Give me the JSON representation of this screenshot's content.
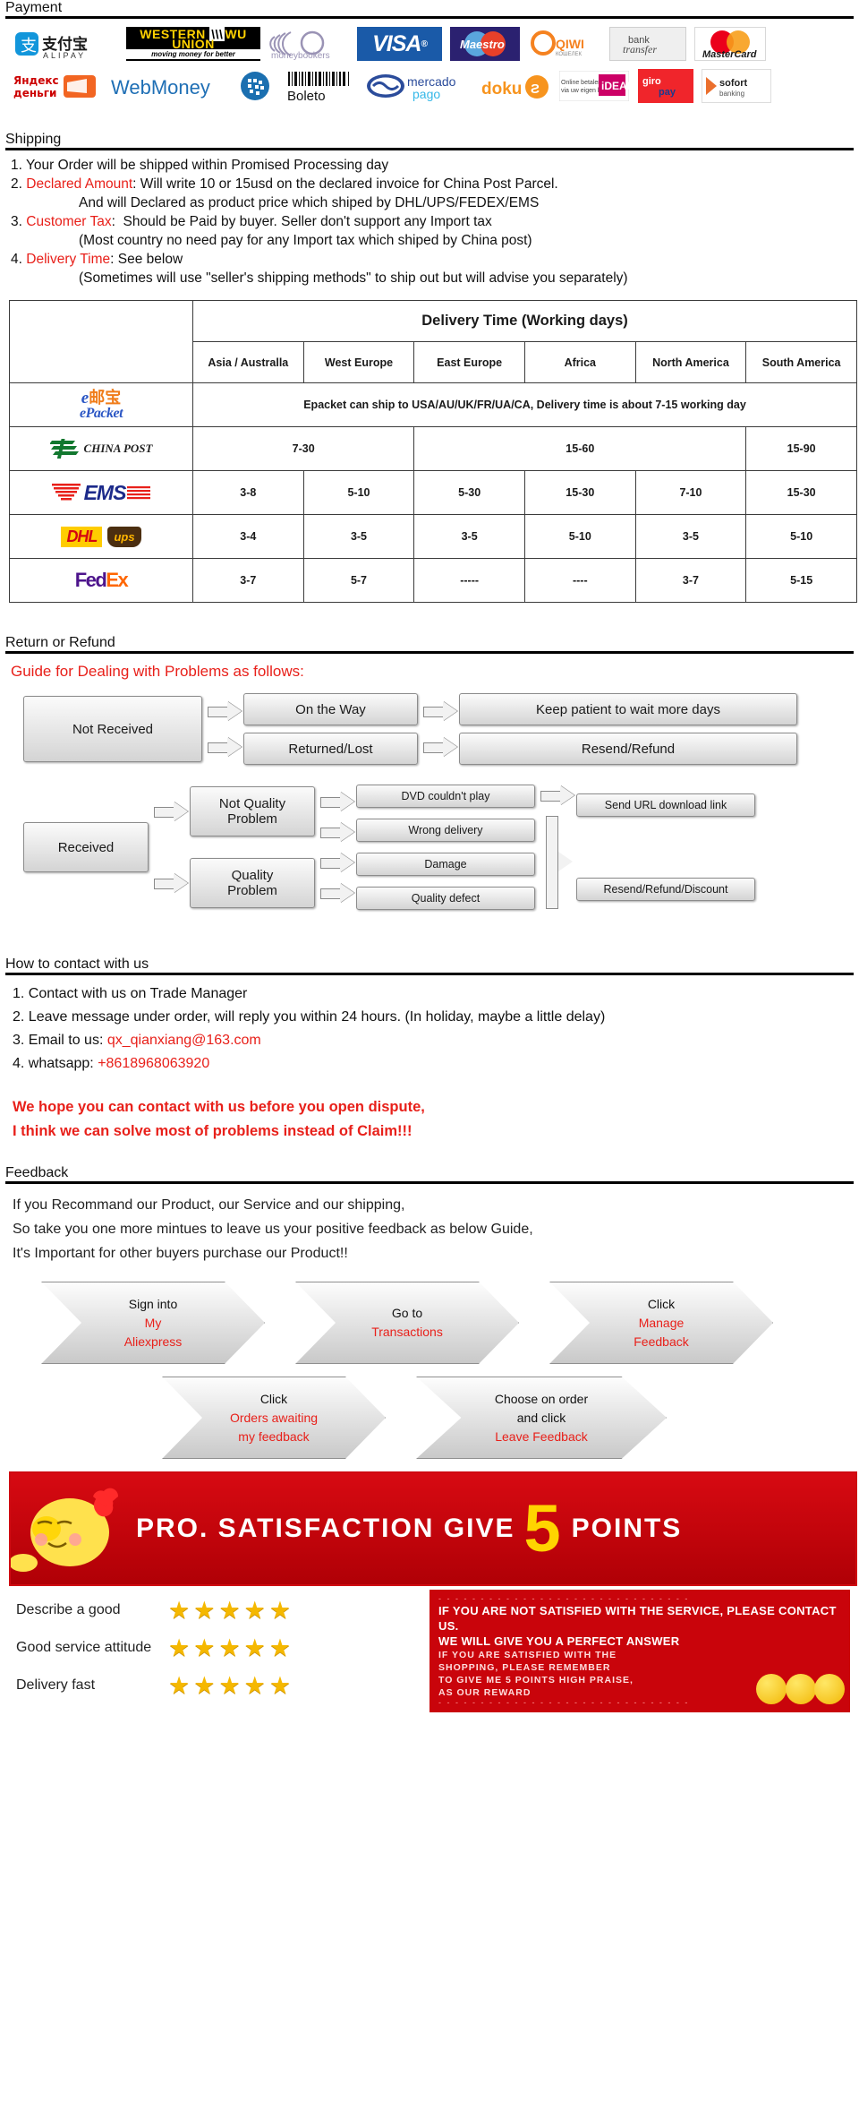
{
  "sections": {
    "payment": "Payment",
    "shipping": "Shipping",
    "return": "Return or Refund",
    "contact": "How to contact with us",
    "feedback": "Feedback"
  },
  "payment_methods": {
    "row1": [
      {
        "name": "alipay-logo",
        "text": "支付宝",
        "sub": "A L I P A Y"
      },
      {
        "name": "western-union-logo",
        "text": "WESTERN UNION",
        "sub": "moving money for better"
      },
      {
        "name": "moneybookers-logo",
        "text": "moneybookers",
        "sub": ""
      },
      {
        "name": "visa-logo",
        "text": "VISA",
        "sub": ""
      },
      {
        "name": "maestro-logo",
        "text": "Maestro",
        "sub": ""
      },
      {
        "name": "qiwi-logo",
        "text": "QIWI",
        "sub": ""
      },
      {
        "name": "bank-transfer-logo",
        "text": "bank",
        "sub": "transfer"
      },
      {
        "name": "mastercard-logo",
        "text": "MasterCard",
        "sub": ""
      }
    ],
    "row2": [
      {
        "name": "yandex-money-logo",
        "text": "Яндекс",
        "sub": "деньги"
      },
      {
        "name": "webmoney-logo",
        "text": "WebMoney",
        "sub": ""
      },
      {
        "name": "dotpay-logo",
        "text": "",
        "sub": ""
      },
      {
        "name": "boleto-logo",
        "text": "Boleto",
        "sub": ""
      },
      {
        "name": "mercado-pago-logo",
        "text": "mercado",
        "sub": "pago"
      },
      {
        "name": "doku-logo",
        "text": "doku",
        "sub": ""
      },
      {
        "name": "ideal-logo",
        "text": "iDEAL",
        "sub": "Online betalen via uw eigen bank"
      },
      {
        "name": "giropay-logo",
        "text": "giro",
        "sub": "pay"
      },
      {
        "name": "sofort-logo",
        "text": "sofort",
        "sub": "banking"
      }
    ]
  },
  "shipping_notes": [
    {
      "num": "1.",
      "label": "",
      "text": "Your Order will be shipped within Promised Processing day",
      "indent": false
    },
    {
      "num": "2.",
      "label": "Declared Amount",
      "text": ": Will write 10 or 15usd on the declared invoice for China Post Parcel.",
      "indent": false
    },
    {
      "num": "",
      "label": "",
      "text": "And will Declared as product price which shiped by DHL/UPS/FEDEX/EMS",
      "indent": true
    },
    {
      "num": "3.",
      "label": "Customer Tax",
      "text": ":  Should be Paid by buyer. Seller don't support any Import tax",
      "indent": false
    },
    {
      "num": "",
      "label": "",
      "text": "(Most country no need pay for any Import tax which shiped by China post)",
      "indent": true
    },
    {
      "num": "4.",
      "label": "Delivery Time",
      "text": ": See below",
      "indent": false
    },
    {
      "num": "",
      "label": "",
      "text": "(Sometimes will use \"seller's shipping methods\" to ship out but will advise you separately)",
      "indent": true
    }
  ],
  "delivery_table": {
    "title": "Delivery Time (Working days)",
    "regions": [
      "Asia / Australla",
      "West Europe",
      "East Europe",
      "Africa",
      "North America",
      "South America"
    ],
    "rows": [
      {
        "carrier": "epacket-logo",
        "carrier_text": "ePacket",
        "span_note": "Epacket can ship to USA/AU/UK/FR/UA/CA, Delivery time is about 7-15 working day",
        "values": []
      },
      {
        "carrier": "china-post-logo",
        "carrier_text": "CHINA POST",
        "span_note": "",
        "values": [
          "7-30",
          "7-30",
          "15-60",
          "15-60",
          "15-60",
          "15-90"
        ],
        "merges": [
          [
            0,
            2
          ],
          [
            2,
            3
          ],
          [
            5,
            1
          ]
        ],
        "merged_values": [
          "7-30",
          "15-60",
          "15-90"
        ]
      },
      {
        "carrier": "ems-logo",
        "carrier_text": "EMS",
        "span_note": "",
        "values": [
          "3-8",
          "5-10",
          "5-30",
          "15-30",
          "7-10",
          "15-30"
        ]
      },
      {
        "carrier": "dhl-ups-logo",
        "carrier_text": "DHL ups",
        "span_note": "",
        "values": [
          "3-4",
          "3-5",
          "3-5",
          "5-10",
          "3-5",
          "5-10"
        ]
      },
      {
        "carrier": "fedex-logo",
        "carrier_text": "FedEx",
        "span_note": "",
        "values": [
          "3-7",
          "5-7",
          "-----",
          "----",
          "3-7",
          "5-15"
        ]
      }
    ]
  },
  "return_flow": {
    "title": "Guide for Dealing with Problems as follows:",
    "not_received": "Not Received",
    "on_the_way": "On the Way",
    "returned_lost": "Returned/Lost",
    "keep_patient": "Keep patient to wait more days",
    "resend_refund": "Resend/Refund",
    "received": "Received",
    "not_quality_problem": "Not Quality\nProblem",
    "quality_problem": "Quality\nProblem",
    "dvd": "DVD couldn't play",
    "wrong_delivery": "Wrong delivery",
    "damage": "Damage",
    "quality_defect": "Quality defect",
    "send_url": "Send URL download link",
    "resend_refund_discount": "Resend/Refund/Discount"
  },
  "contact_items": [
    {
      "num": "1.",
      "text": "Contact with us on Trade Manager",
      "highlight": ""
    },
    {
      "num": "2.",
      "text": "Leave message under order, will reply you within 24 hours. (In holiday, maybe a little delay)",
      "highlight": ""
    },
    {
      "num": "3.",
      "text": "Email to us: ",
      "highlight": "qx_qianxiang@163.com"
    },
    {
      "num": "4.",
      "text": "whatsapp: ",
      "highlight": "+8618968063920"
    }
  ],
  "contact_warning": [
    "We hope you can contact with us before you open dispute,",
    "I think we can solve most of problems instead of Claim!!!"
  ],
  "feedback_intro": [
    "If you Recommand our Product, our Service and our shipping,",
    "So take you one more mintues to leave us your positive feedback as below Guide,",
    "It's Important for other buyers purchase our Product!!"
  ],
  "feedback_steps_row1": [
    {
      "black": "Sign into",
      "red1": "My",
      "red2": "Aliexpress"
    },
    {
      "black": "Go to",
      "red1": "Transactions",
      "red2": ""
    },
    {
      "black": "Click",
      "red1": "Manage",
      "red2": "Feedback"
    }
  ],
  "feedback_steps_row2": [
    {
      "black": "Click",
      "red1": "Orders awaiting",
      "red2": "my feedback"
    },
    {
      "black": "Choose on order\nand click",
      "red1": "Leave Feedback",
      "red2": ""
    }
  ],
  "banner": {
    "text_before": "PRO. SATISFACTION GIVE",
    "number": "5",
    "text_after": "POINTS"
  },
  "ratings": [
    {
      "label": "Describe a good",
      "stars": 5
    },
    {
      "label": "Good service attitude",
      "stars": 5
    },
    {
      "label": "Delivery fast",
      "stars": 5
    }
  ],
  "red_notice": {
    "line1": "IF YOU ARE NOT SATISFIED WITH THE SERVICE, PLEASE CONTACT US.",
    "line2": "WE WILL GIVE YOU A PERFECT ANSWER",
    "line3": "IF YOU ARE SATISFIED WITH THE",
    "line4": "SHOPPING, PLEASE REMEMBER",
    "line5": "TO GIVE ME 5 POINTS HIGH PRAISE,",
    "line6": "AS OUR REWARD"
  },
  "colors": {
    "accent_red": "#e8201a",
    "banner_red": "#c9040b",
    "star_gold": "#f5b800",
    "header_black": "#000000"
  },
  "star_glyph": "★"
}
